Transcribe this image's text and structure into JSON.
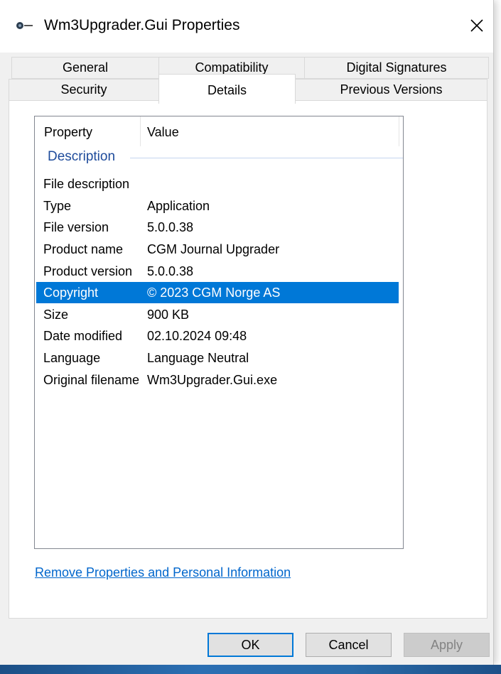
{
  "window": {
    "title": "Wm3Upgrader.Gui Properties"
  },
  "title_icon": "file-properties-icon",
  "tabs_row1": [
    {
      "label": "General"
    },
    {
      "label": "Compatibility"
    },
    {
      "label": "Digital Signatures"
    }
  ],
  "tabs_row2": [
    {
      "label": "Security"
    },
    {
      "label": "Details",
      "active": true
    },
    {
      "label": "Previous Versions"
    }
  ],
  "details": {
    "columns": {
      "property": "Property",
      "value": "Value"
    },
    "group": "Description",
    "rows": [
      {
        "property": "File description",
        "value": ""
      },
      {
        "property": "Type",
        "value": "Application"
      },
      {
        "property": "File version",
        "value": "5.0.0.38"
      },
      {
        "property": "Product name",
        "value": "CGM Journal Upgrader"
      },
      {
        "property": "Product version",
        "value": "5.0.0.38"
      },
      {
        "property": "Copyright",
        "value": "© 2023 CGM Norge AS",
        "selected": true
      },
      {
        "property": "Size",
        "value": "900 KB"
      },
      {
        "property": "Date modified",
        "value": "02.10.2024 09:48"
      },
      {
        "property": "Language",
        "value": "Language Neutral"
      },
      {
        "property": "Original filename",
        "value": "Wm3Upgrader.Gui.exe"
      }
    ]
  },
  "remove_link": "Remove Properties and Personal Information",
  "buttons": {
    "ok": "OK",
    "cancel": "Cancel",
    "apply": "Apply"
  },
  "colors": {
    "selection": "#0078d7",
    "link": "#0066cc",
    "group_header": "#1e4b9b"
  }
}
